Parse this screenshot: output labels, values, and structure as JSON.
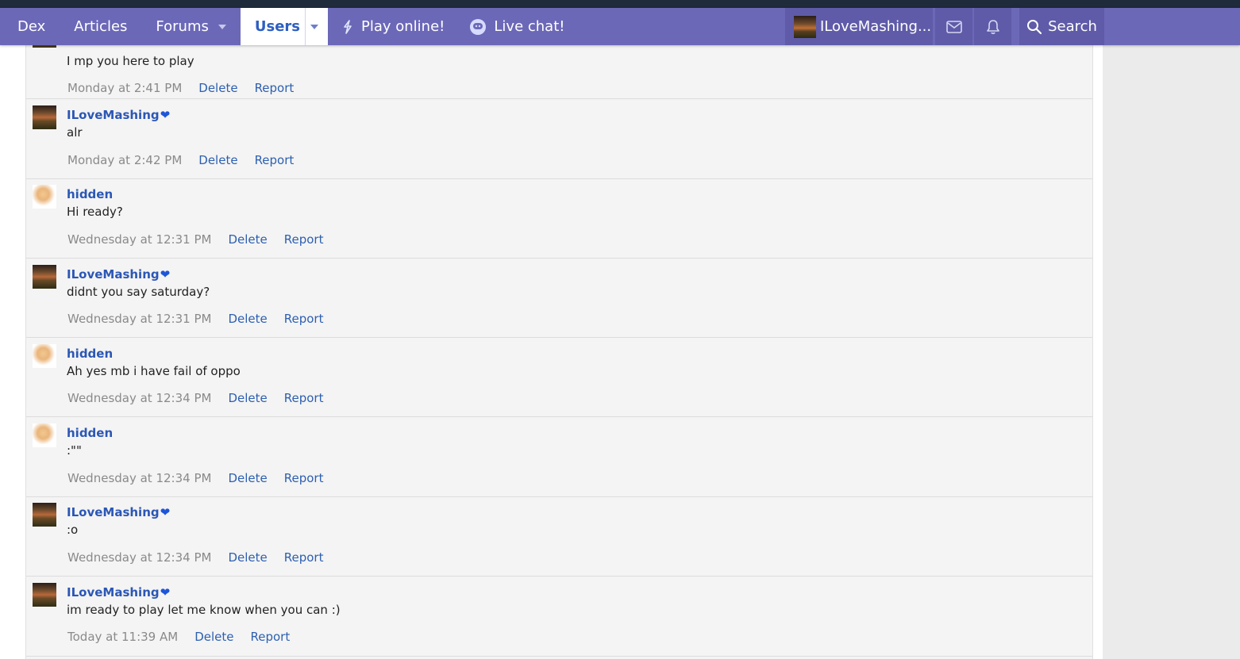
{
  "nav": {
    "items": [
      {
        "label": "Dex"
      },
      {
        "label": "Articles"
      },
      {
        "label": "Forums"
      },
      {
        "label": "Users"
      },
      {
        "label": "Play online!"
      },
      {
        "label": "Live chat!"
      }
    ],
    "account_name": "ILoveMashing...",
    "search_label": "Search"
  },
  "messages": [
    {
      "author": "",
      "text": "I mp you here to play",
      "time": "Monday at 2:41 PM",
      "delete": "Delete",
      "report": "Report"
    },
    {
      "author": "ILoveMashing",
      "text": "alr",
      "time": "Monday at 2:42 PM",
      "delete": "Delete",
      "report": "Report"
    },
    {
      "author": "hidden",
      "text": "Hi ready?",
      "time": "Wednesday at 12:31 PM",
      "delete": "Delete",
      "report": "Report"
    },
    {
      "author": "ILoveMashing",
      "text": "didnt you say saturday?",
      "time": "Wednesday at 12:31 PM",
      "delete": "Delete",
      "report": "Report"
    },
    {
      "author": "hidden",
      "text": "Ah yes mb i have fail of oppo",
      "time": "Wednesday at 12:34 PM",
      "delete": "Delete",
      "report": "Report"
    },
    {
      "author": "hidden",
      "text": ":\"\"",
      "time": "Wednesday at 12:34 PM",
      "delete": "Delete",
      "report": "Report"
    },
    {
      "author": "ILoveMashing",
      "text": ":o",
      "time": "Wednesday at 12:34 PM",
      "delete": "Delete",
      "report": "Report"
    },
    {
      "author": "ILoveMashing",
      "text": "im ready to play let me know when you can :)",
      "time": "Today at 11:39 AM",
      "delete": "Delete",
      "report": "Report"
    }
  ],
  "colors": {
    "navbar": "#6c68b8",
    "link": "#2d5fb0",
    "author": "#2b57b5"
  }
}
